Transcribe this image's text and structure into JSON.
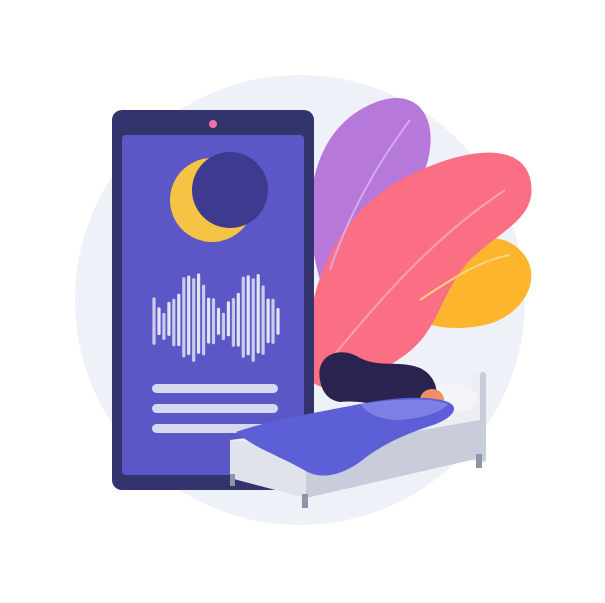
{
  "illustration": {
    "subject": "sleep-tracking-app",
    "icons": [
      "moon-icon",
      "sleep-wave-chart-icon",
      "bed-icon",
      "leaf-icon"
    ]
  },
  "colors": {
    "background_circle": "#eef1f7",
    "phone_body": "#33346e",
    "phone_screen": "#5c57c7",
    "moon": "#f6c444",
    "moon_shadow": "#3d3a8f",
    "wave_bars": "#e3e4f4",
    "text_lines": "#d7d9f1",
    "leaf_purple": "#b678d9",
    "leaf_pink": "#fb6f84",
    "leaf_orange": "#fcb52c",
    "blanket": "#5d5fd6",
    "hair": "#2a2350",
    "bed_frame": "#eceef4",
    "bed_side": "#c9ccda"
  }
}
